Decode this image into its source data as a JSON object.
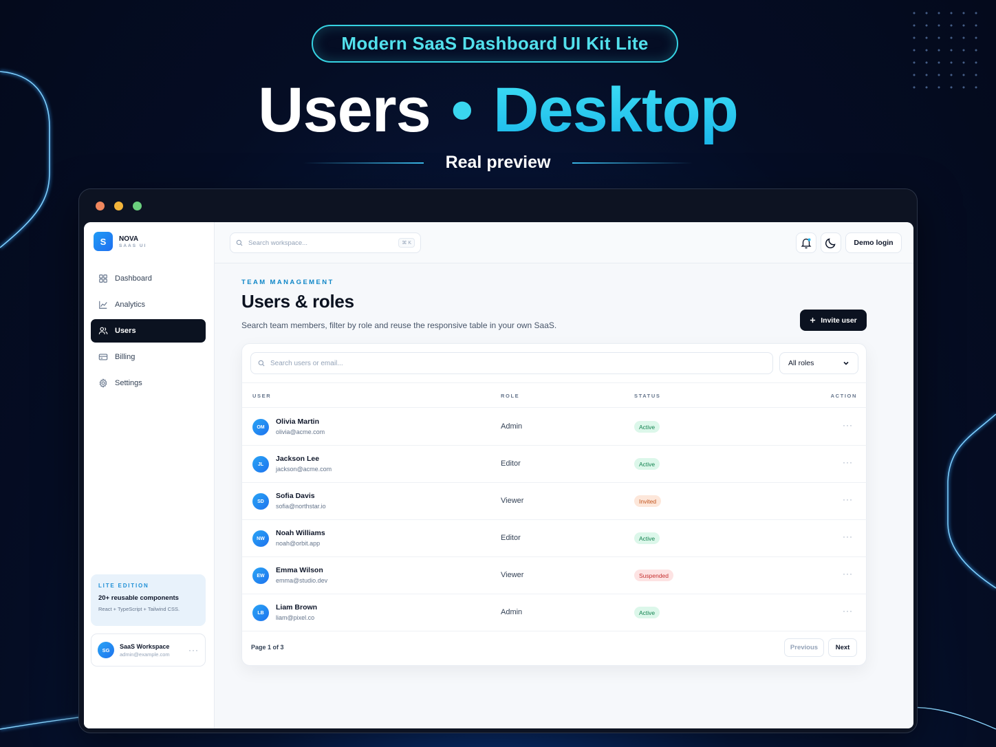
{
  "hero": {
    "pill": "Modern SaaS Dashboard UI Kit Lite",
    "title_left": "Users",
    "title_sep": "•",
    "title_right": "Desktop",
    "subtitle": "Real preview"
  },
  "colors": {
    "accent_cyan": "#36d3e3",
    "dark_button": "#0b1220",
    "brand_blue": "#1f9bf5",
    "traffic_red": "#f0875e",
    "traffic_yellow": "#f3b43a",
    "traffic_green": "#6bcf7e"
  },
  "sidebar": {
    "brand_initial": "S",
    "brand_name": "NOVA",
    "brand_sub": "SAAS UI",
    "items": [
      {
        "label": "Dashboard",
        "icon": "grid-icon",
        "active": false
      },
      {
        "label": "Analytics",
        "icon": "chart-icon",
        "active": false
      },
      {
        "label": "Users",
        "icon": "users-icon",
        "active": true
      },
      {
        "label": "Billing",
        "icon": "card-icon",
        "active": false
      },
      {
        "label": "Settings",
        "icon": "settings-icon",
        "active": false
      }
    ],
    "promo": {
      "kicker": "LITE EDITION",
      "headline": "20+ reusable components",
      "stack": "React + TypeScript + Tailwind CSS."
    },
    "workspace": {
      "initials": "SG",
      "name": "SaaS Workspace",
      "email": "admin@example.com",
      "more": "···"
    }
  },
  "topbar": {
    "search_placeholder": "Search workspace...",
    "shortcut": "⌘ K",
    "login_label": "Demo login"
  },
  "main": {
    "eyebrow": "TEAM MANAGEMENT",
    "title": "Users & roles",
    "description": "Search team members, filter by role and reuse the responsive table in your own SaaS.",
    "invite_label": "Invite user",
    "filter_placeholder": "Search users or email...",
    "role_filter": "All roles",
    "columns": [
      "USER",
      "ROLE",
      "STATUS",
      "ACTION"
    ],
    "rows": [
      {
        "initials": "OM",
        "name": "Olivia Martin",
        "email": "olivia@acme.com",
        "role": "Admin",
        "status": "Active",
        "status_kind": "active"
      },
      {
        "initials": "JL",
        "name": "Jackson Lee",
        "email": "jackson@acme.com",
        "role": "Editor",
        "status": "Active",
        "status_kind": "active"
      },
      {
        "initials": "SD",
        "name": "Sofia Davis",
        "email": "sofia@northstar.io",
        "role": "Viewer",
        "status": "Invited",
        "status_kind": "invited"
      },
      {
        "initials": "NW",
        "name": "Noah Williams",
        "email": "noah@orbit.app",
        "role": "Editor",
        "status": "Active",
        "status_kind": "active"
      },
      {
        "initials": "EW",
        "name": "Emma Wilson",
        "email": "emma@studio.dev",
        "role": "Viewer",
        "status": "Suspended",
        "status_kind": "suspended"
      },
      {
        "initials": "LB",
        "name": "Liam Brown",
        "email": "liam@pixel.co",
        "role": "Admin",
        "status": "Active",
        "status_kind": "active"
      }
    ],
    "row_more": "···",
    "pagination": {
      "label": "Page 1 of 3",
      "prev": "Previous",
      "next": "Next"
    }
  }
}
